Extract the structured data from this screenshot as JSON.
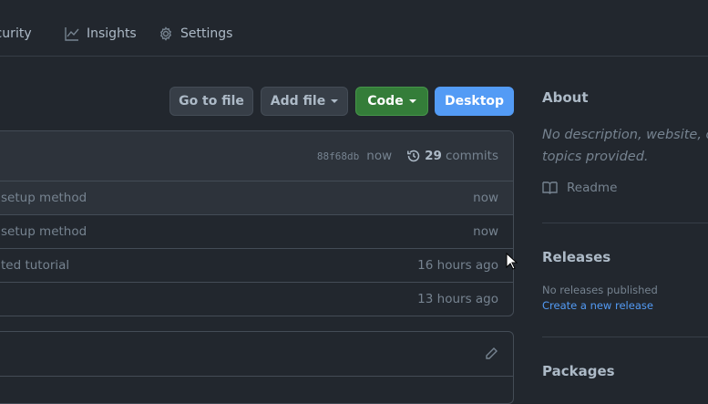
{
  "nav": {
    "security": "ecurity",
    "insights": "Insights",
    "settings": "Settings"
  },
  "toolbar": {
    "go_to_file": "Go to file",
    "add_file": "Add file",
    "code": "Code",
    "desktop": "Desktop"
  },
  "colors": {
    "code_button": "#347d39",
    "desktop_button": "#539bf5",
    "link": "#539bf5"
  },
  "commit_bar": {
    "hash": "88f68db",
    "time": "now",
    "count": "29",
    "count_label": "commits"
  },
  "files": [
    {
      "message": "setup method",
      "time": "now"
    },
    {
      "message": "setup method",
      "time": "now"
    },
    {
      "message": "ted tutorial",
      "time": "16 hours ago"
    },
    {
      "message": "",
      "time": "13 hours ago"
    }
  ],
  "about": {
    "title": "About",
    "description": "No description, website, or topics provided.",
    "readme": "Readme"
  },
  "releases": {
    "title": "Releases",
    "none": "No releases published",
    "create": "Create a new release"
  },
  "packages": {
    "title": "Packages"
  }
}
